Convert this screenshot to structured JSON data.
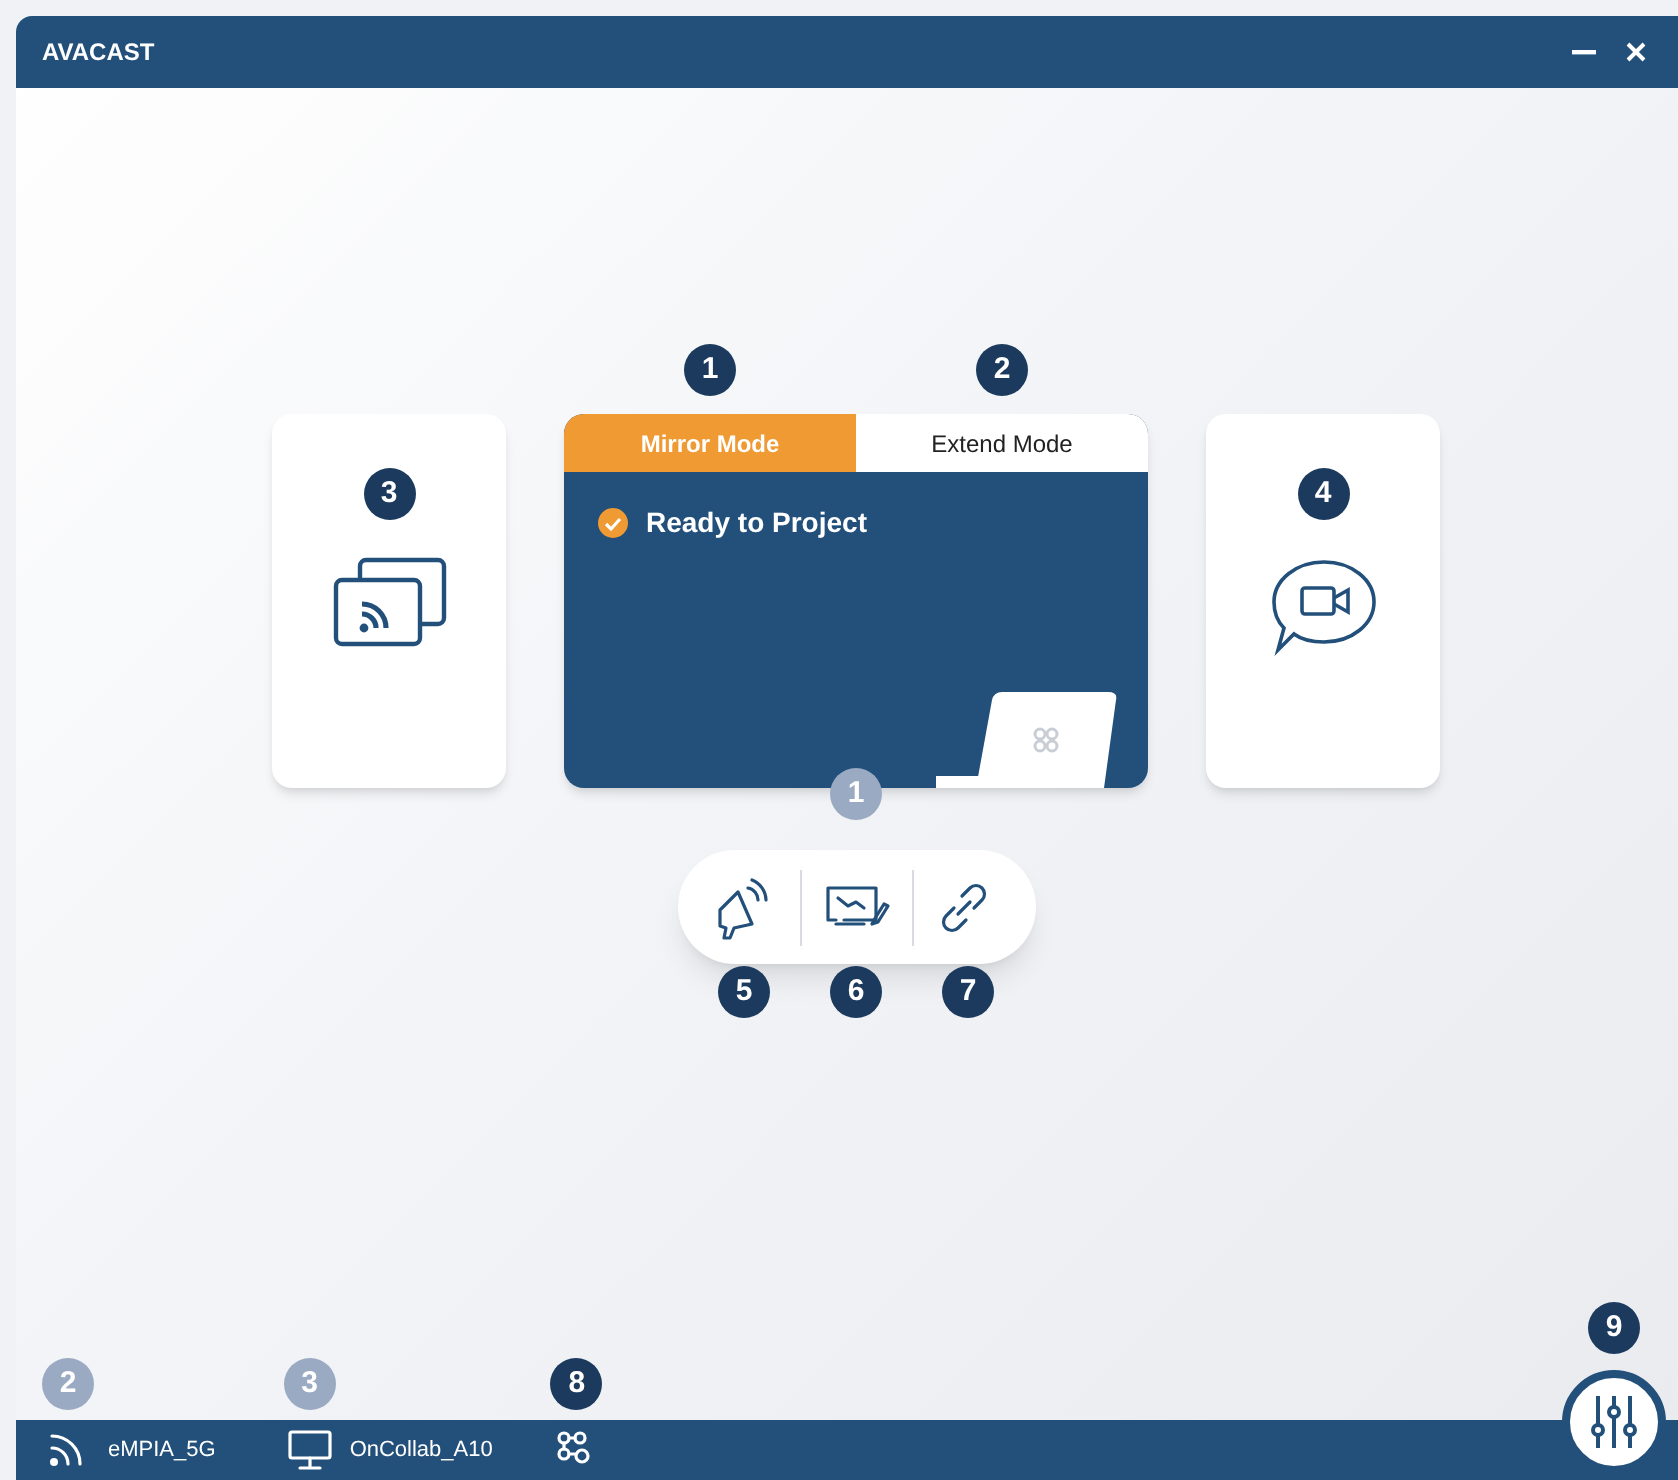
{
  "window": {
    "title": "AVACAST"
  },
  "mode_card": {
    "tabs": [
      {
        "label": "Mirror Mode",
        "selected": true,
        "callout": {
          "number": "1",
          "kind": "dark"
        }
      },
      {
        "label": "Extend Mode",
        "selected": false,
        "callout": {
          "number": "2",
          "kind": "dark"
        }
      }
    ],
    "status": {
      "text": "Ready to Project",
      "checked": true
    },
    "callout": {
      "number": "1",
      "kind": "light"
    }
  },
  "side_cards": [
    {
      "kind": "cast",
      "callout": {
        "number": "3",
        "kind": "dark"
      }
    },
    {
      "kind": "video-chat",
      "callout": {
        "number": "4",
        "kind": "dark"
      }
    }
  ],
  "toolbar": [
    {
      "kind": "speaker",
      "callout": {
        "number": "5",
        "kind": "dark"
      }
    },
    {
      "kind": "whiteboard",
      "callout": {
        "number": "6",
        "kind": "dark"
      }
    },
    {
      "kind": "link",
      "callout": {
        "number": "7",
        "kind": "dark"
      }
    }
  ],
  "status_bar": {
    "items": [
      {
        "kind": "wifi",
        "label": "eMPIA_5G",
        "callout": {
          "number": "2",
          "kind": "light"
        }
      },
      {
        "kind": "display",
        "label": "OnCollab_A10",
        "callout": {
          "number": "3",
          "kind": "light"
        }
      },
      {
        "kind": "network-settings",
        "callout": {
          "number": "8",
          "kind": "dark"
        }
      }
    ],
    "settings_callout": {
      "number": "9",
      "kind": "dark"
    }
  }
}
